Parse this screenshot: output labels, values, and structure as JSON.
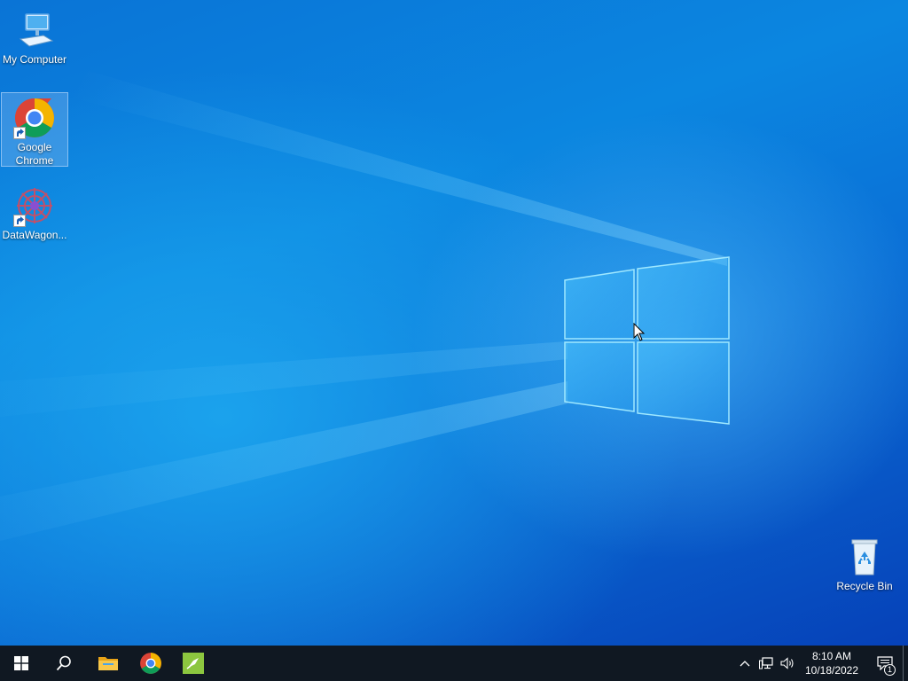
{
  "desktop": {
    "icons": [
      {
        "label": "My Computer",
        "icon": "computer-icon"
      },
      {
        "label": "Google Chrome",
        "icon": "chrome-icon",
        "selected": true
      },
      {
        "label": "DataWagon...",
        "icon": "datawagon-icon"
      },
      {
        "label": "Recycle Bin",
        "icon": "recycle-bin-icon"
      }
    ]
  },
  "taskbar": {
    "pinned": [
      {
        "name": "start",
        "icon": "windows-start-icon"
      },
      {
        "name": "search",
        "icon": "search-icon"
      },
      {
        "name": "file-explorer",
        "icon": "folder-icon"
      },
      {
        "name": "chrome",
        "icon": "chrome-icon"
      },
      {
        "name": "app",
        "icon": "green-app-icon"
      }
    ],
    "tray": {
      "time": "8:10 AM",
      "date": "10/18/2022",
      "notification_count": "1"
    }
  },
  "colors": {
    "taskbar_bg": "#101822",
    "accent": "#0a74d6"
  }
}
